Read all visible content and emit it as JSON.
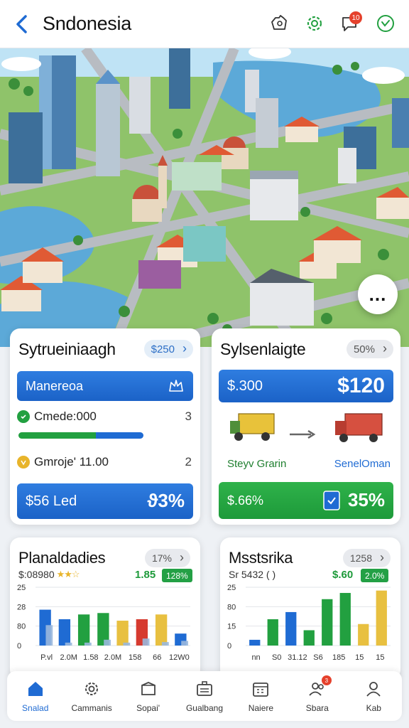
{
  "header": {
    "title": "Sndonesia",
    "icons": [
      "back-icon",
      "cart-icon",
      "settings-gear-icon",
      "notification-chat-icon",
      "heart-check-icon"
    ],
    "notification_count": "10"
  },
  "scene": {
    "chat_button": "..."
  },
  "card1": {
    "title": "Sytrueiniaagh",
    "pill": "$250",
    "banner_label": "Manereoa",
    "row1_label": "Cmede:000",
    "row1_count": "3",
    "progress_green": 0.62,
    "progress_blue": 0.38,
    "row2_label": "Gmroje' 11.00",
    "row2_count": "2",
    "footer_label": "$56 Led",
    "footer_value": "ϑ3%"
  },
  "card2": {
    "title": "Sylsenlaigte",
    "pill": "50%",
    "banner_label": "$.300",
    "banner_value": "$120",
    "truck_left_label": "Steyv Grarin",
    "truck_right_label": "SenelOman",
    "footer_label": "$.66%",
    "footer_value": "35%"
  },
  "chart1": {
    "title": "Planaldadies",
    "pill": "17%",
    "subtitle": "$:08980",
    "stars": "★★☆",
    "right_num": "1.85",
    "chip": "128%"
  },
  "chart2": {
    "title": "Msstsrika",
    "pill": "1258",
    "subtitle": "Sr 5432 ( )",
    "right_num": "$.60",
    "chip": "2.0%"
  },
  "chart_data": [
    {
      "type": "bar",
      "yticks": [
        "25",
        "28",
        "80",
        "0"
      ],
      "categories": [
        "P.vl",
        "2.0M",
        "1.58",
        "2.0M",
        "158",
        "66",
        "12W0"
      ],
      "values": [
        0.75,
        0.55,
        0.65,
        0.68,
        0.52,
        0.55,
        0.65,
        0.25
      ],
      "secondary": [
        0.35,
        0.05,
        0.05,
        0.1,
        0.05,
        0.12,
        0.06,
        0.08
      ],
      "colors": [
        "#1f6bd3",
        "#1f6bd3",
        "#22a040",
        "#22a040",
        "#e8c040",
        "#d63a2f",
        "#e8c040"
      ]
    },
    {
      "type": "bar",
      "yticks": [
        "25",
        "80",
        "15",
        "0"
      ],
      "categories": [
        "nn",
        "S0",
        "31.12",
        "S6",
        "185",
        "15",
        "15"
      ],
      "values": [
        0.12,
        0.55,
        0.7,
        0.32,
        0.97,
        1.1,
        0.45,
        1.2
      ],
      "colors": [
        "#1f6bd3",
        "#22a040",
        "#1f6bd3",
        "#22a040",
        "#22a040",
        "#22a040",
        "#e8c040",
        "#e8c040"
      ]
    }
  ],
  "nav": {
    "items": [
      {
        "label": "Snalad",
        "icon": "home-icon",
        "active": true
      },
      {
        "label": "Cammanis",
        "icon": "gear-icon"
      },
      {
        "label": "Sopai'",
        "icon": "box-icon"
      },
      {
        "label": "Gualbang",
        "icon": "briefcase-icon"
      },
      {
        "label": "Naiere",
        "icon": "calendar-icon"
      },
      {
        "label": "Sbara",
        "icon": "people-icon",
        "badge": "3"
      },
      {
        "label": "Kab",
        "icon": "profile-icon"
      }
    ]
  },
  "colors": {
    "accent_blue": "#1f6bd3",
    "accent_green": "#22a040",
    "alert_red": "#e5412c"
  }
}
